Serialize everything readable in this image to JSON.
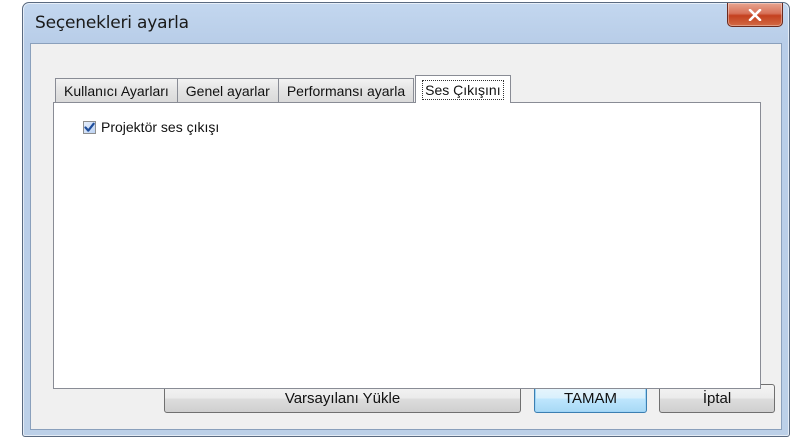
{
  "window": {
    "title": "Seçenekleri ayarla"
  },
  "tabs": [
    {
      "label": "Kullanıcı Ayarları",
      "active": false
    },
    {
      "label": "Genel ayarlar",
      "active": false
    },
    {
      "label": "Performansı ayarla",
      "active": false
    },
    {
      "label": "Ses Çıkışını",
      "active": true
    }
  ],
  "panel": {
    "projector_audio": {
      "label": "Projektör ses çıkışı",
      "checked": true
    }
  },
  "buttons": {
    "load_defaults": "Varsayılanı Yükle",
    "ok": "TAMAM",
    "cancel": "İptal"
  },
  "icons": {
    "close": "close-icon",
    "check": "check-icon"
  },
  "colors": {
    "close_button": "#c4401f",
    "title_bar": "#bcd0e8",
    "checkmark": "#1f4e9c"
  }
}
